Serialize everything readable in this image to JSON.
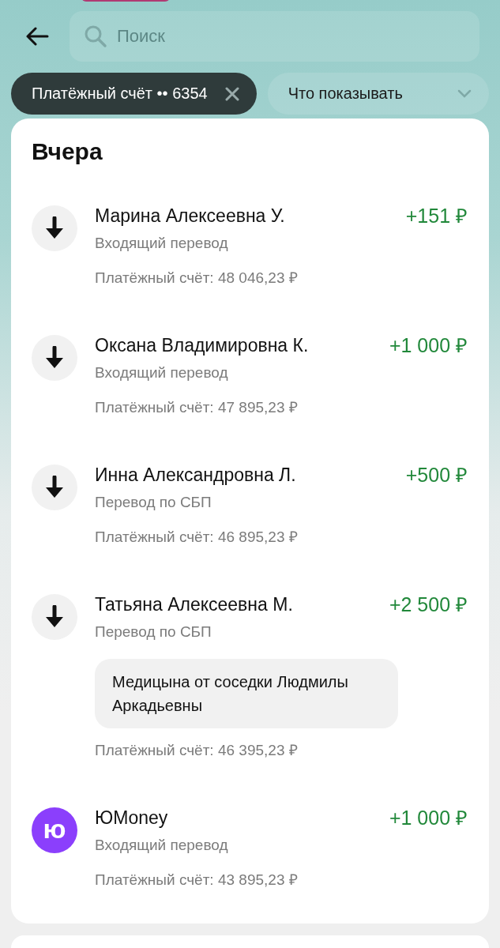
{
  "search": {
    "placeholder": "Поиск"
  },
  "filters": [
    {
      "kind": "account",
      "label": "Платёжный счёт •• 6354",
      "selected": true
    },
    {
      "kind": "dropdown",
      "label": "Что показывать",
      "selected": false
    }
  ],
  "section": {
    "title": "Вчера"
  },
  "transactions": [
    {
      "kind": "incoming",
      "name": "Марина Алексеевна У.",
      "type": "Входящий перевод",
      "amount": "+151 ₽",
      "balance": "Платёжный счёт: 48 046,23 ₽"
    },
    {
      "kind": "incoming",
      "name": "Оксана Владимировна К.",
      "type": "Входящий перевод",
      "amount": "+1 000 ₽",
      "balance": "Платёжный счёт: 47 895,23 ₽"
    },
    {
      "kind": "incoming",
      "name": "Инна Александровна Л.",
      "type": "Перевод по СБП",
      "amount": "+500 ₽",
      "balance": "Платёжный счёт: 46 895,23 ₽"
    },
    {
      "kind": "incoming",
      "name": "Татьяна Алексеевна М.",
      "type": "Перевод по СБП",
      "amount": "+2 500 ₽",
      "note": "Медицына от соседки Людмилы Аркадьевны",
      "balance": "Платёжный счёт: 46 395,23 ₽"
    },
    {
      "kind": "merchant",
      "logo_text": "ю",
      "color": "#8b3ffc",
      "name": "ЮMoney",
      "type": "Входящий перевод",
      "amount": "+1 000 ₽",
      "balance": "Платёжный счёт: 43 895,23 ₽"
    }
  ]
}
